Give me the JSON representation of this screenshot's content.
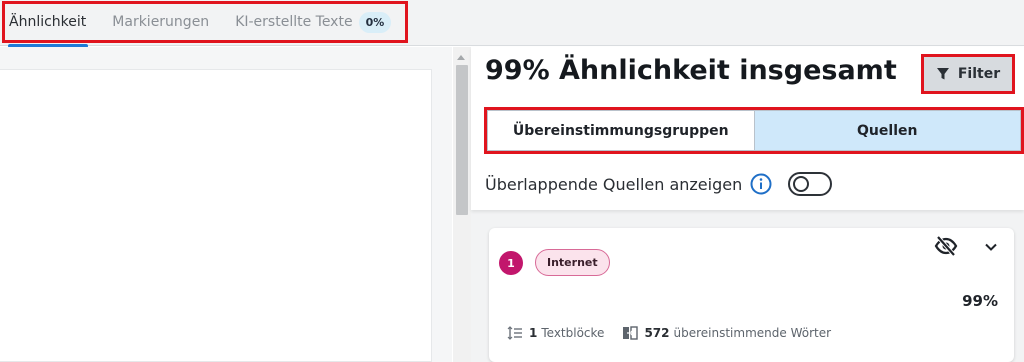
{
  "tabs": [
    {
      "label": "Ähnlichkeit",
      "active": true
    },
    {
      "label": "Markierungen",
      "active": false
    },
    {
      "label": "KI-erstellte Texte",
      "active": false,
      "badge": "0%"
    }
  ],
  "panel": {
    "title": "99% Ähnlichkeit insgesamt",
    "filter_label": "Filter",
    "segments": [
      "Übereinstimmungsgruppen",
      "Quellen"
    ],
    "selected_segment": "Quellen",
    "overlap_label": "Überlappende Quellen anzeigen",
    "overlap_toggle_on": false
  },
  "source_card": {
    "rank": "1",
    "source_type": "Internet",
    "percent": "99%",
    "text_blocks_count": "1",
    "text_blocks_label": "Textblöcke",
    "matching_words_count": "572",
    "matching_words_label": "übereinstimmende Wörter"
  },
  "colors": {
    "highlight_red": "#e0141e",
    "accent_blue": "#1f7ad6",
    "selected_segment_bg": "#cfe8fa",
    "rank_magenta": "#c2166c"
  },
  "icons": [
    "filter-icon",
    "info-icon",
    "eye-off-icon",
    "chevron-down-icon",
    "text-blocks-icon",
    "matching-words-icon"
  ]
}
